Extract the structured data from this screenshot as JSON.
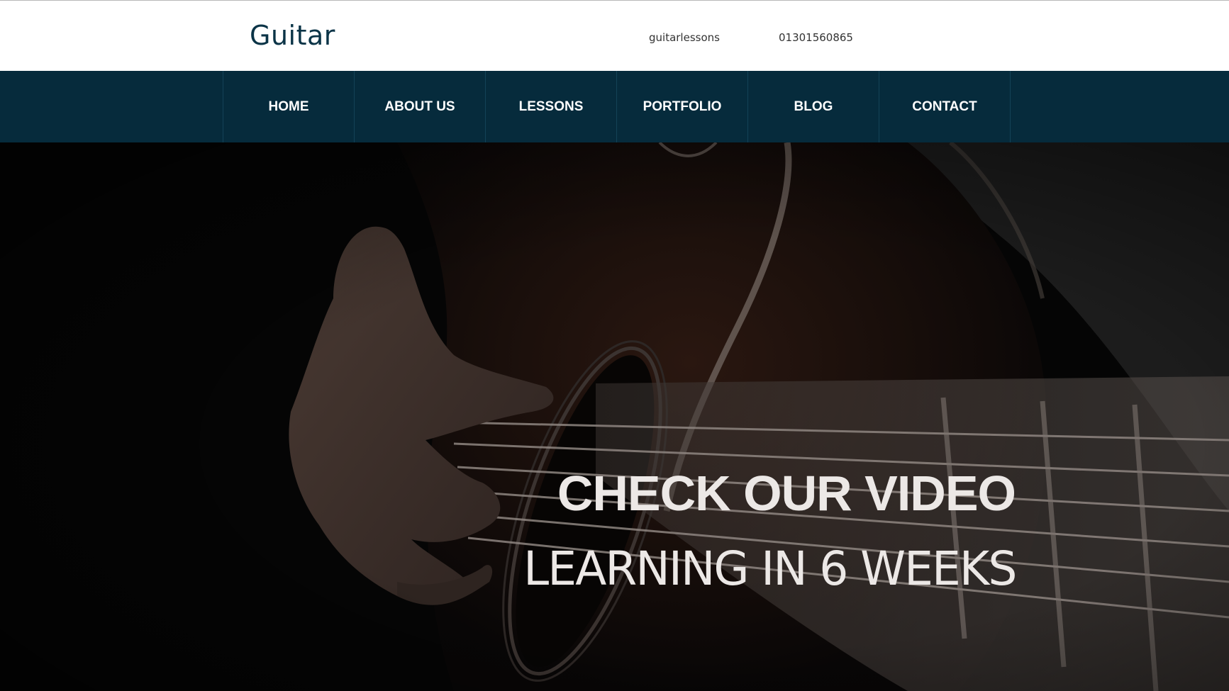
{
  "header": {
    "logo": "Guitar",
    "email": "guitarlessons",
    "phone": "01301560865"
  },
  "nav": {
    "items": [
      {
        "label": "HOME"
      },
      {
        "label": "ABOUT US"
      },
      {
        "label": "LESSONS"
      },
      {
        "label": "PORTFOLIO"
      },
      {
        "label": "BLOG"
      },
      {
        "label": "CONTACT"
      }
    ]
  },
  "hero": {
    "title": "CHECK OUR VIDEO",
    "subtitle": "LEARNING IN 6 WEEKS"
  },
  "colors": {
    "brand": "#0b3447",
    "nav_bg": "#062b3c",
    "hero_text": "#ece8e6"
  }
}
